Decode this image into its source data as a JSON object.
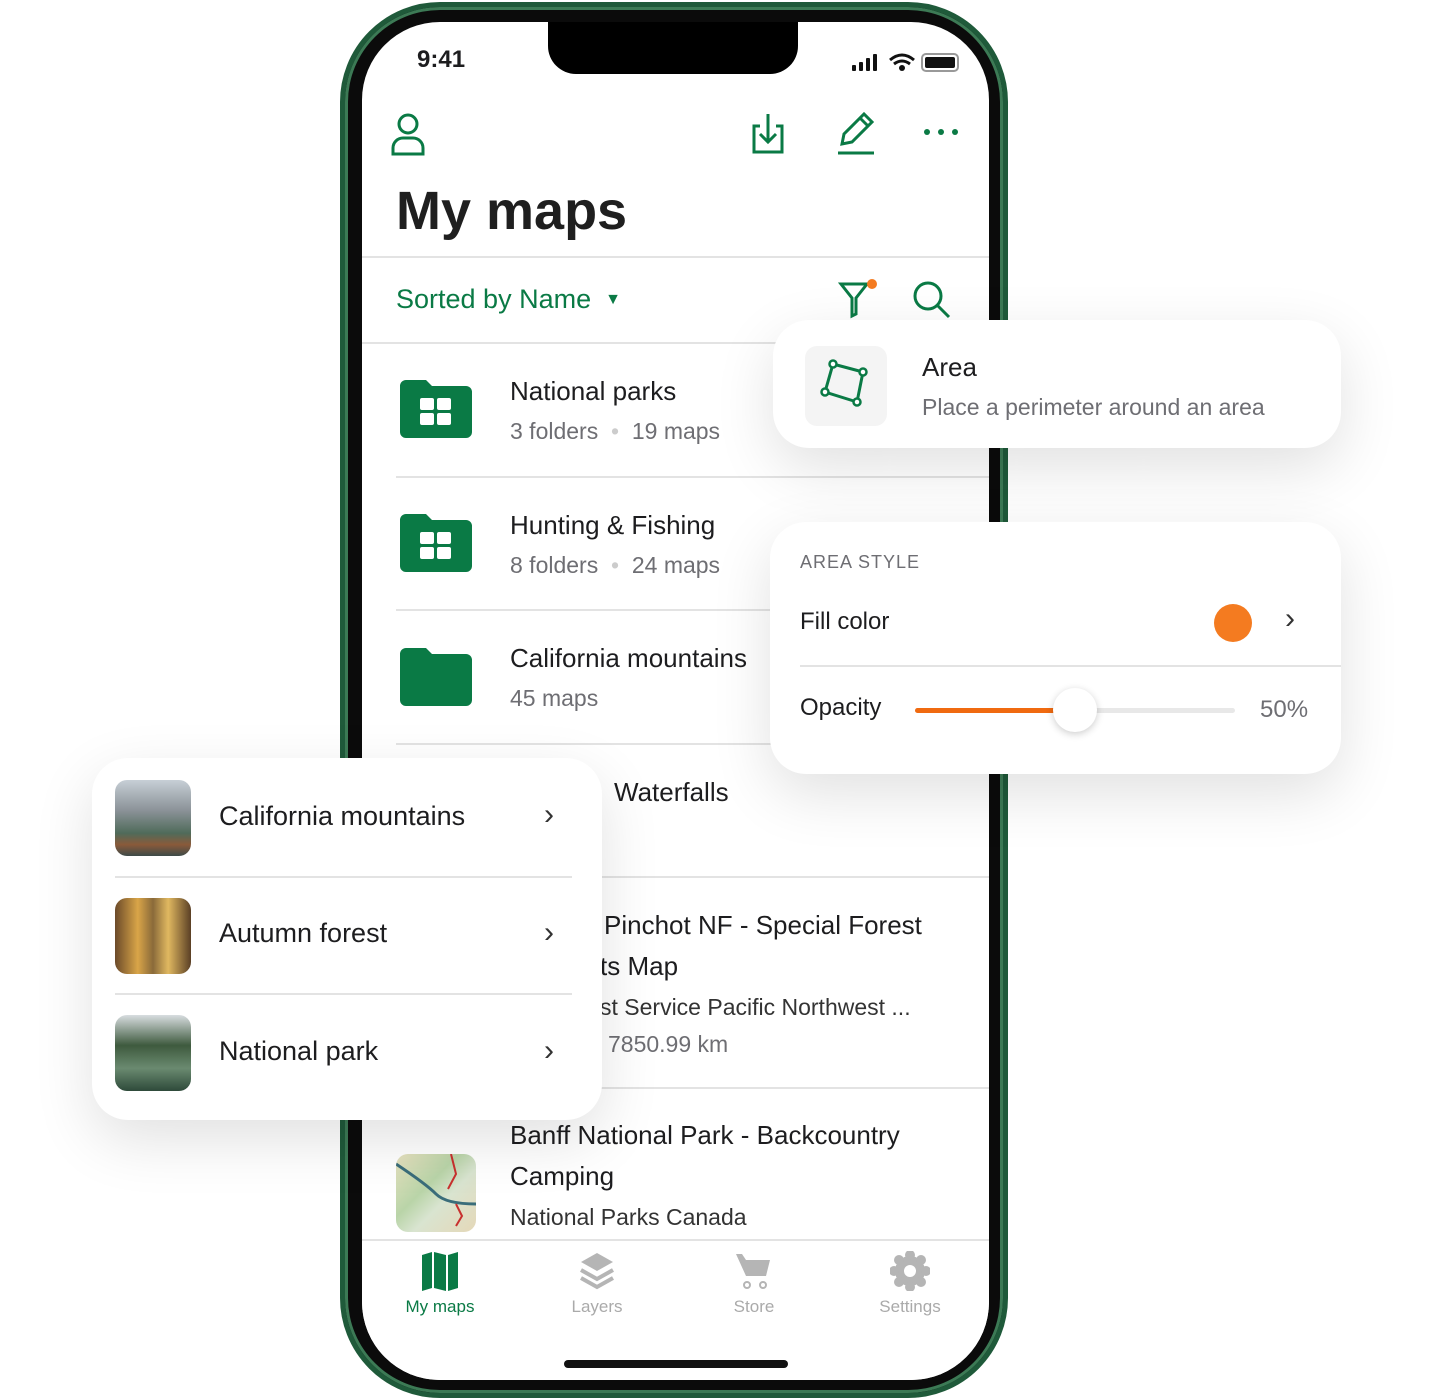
{
  "status_bar": {
    "time": "9:41"
  },
  "header": {
    "title": "My maps"
  },
  "toolbar": {
    "sort_label": "Sorted by Name"
  },
  "list": [
    {
      "title": "National parks",
      "folders": "3 folders",
      "maps": "19 maps"
    },
    {
      "title": "Hunting & Fishing",
      "folders": "8 folders",
      "maps": "24 maps"
    },
    {
      "title": "California mountains",
      "maps": "45 maps"
    },
    {
      "title_fragment": "Waterfalls"
    },
    {
      "title_line1": "Pinchot NF - Special Forest",
      "title_line2": "ts Map",
      "publisher": "st Service Pacific Northwest ...",
      "distance": "7850.99 km"
    },
    {
      "title_line1": "Banff National Park - Backcountry",
      "title_line2": "Camping",
      "publisher": "National Parks Canada"
    }
  ],
  "tabbar": [
    {
      "label": "My maps",
      "icon": "map-icon",
      "active": true
    },
    {
      "label": "Layers",
      "icon": "layers-icon"
    },
    {
      "label": "Store",
      "icon": "cart-icon"
    },
    {
      "label": "Settings",
      "icon": "gear-icon"
    }
  ],
  "area_card": {
    "title": "Area",
    "subtitle": "Place a perimeter around an area"
  },
  "style_card": {
    "section": "AREA STYLE",
    "fill_label": "Fill color",
    "fill_color": "#f47b20",
    "opacity_label": "Opacity",
    "opacity_value": "50%",
    "opacity": 0.5
  },
  "places_card": [
    {
      "label": "California mountains"
    },
    {
      "label": "Autumn forest"
    },
    {
      "label": "National park"
    }
  ],
  "colors": {
    "accent": "#0a7a45",
    "orange": "#f47b20"
  }
}
